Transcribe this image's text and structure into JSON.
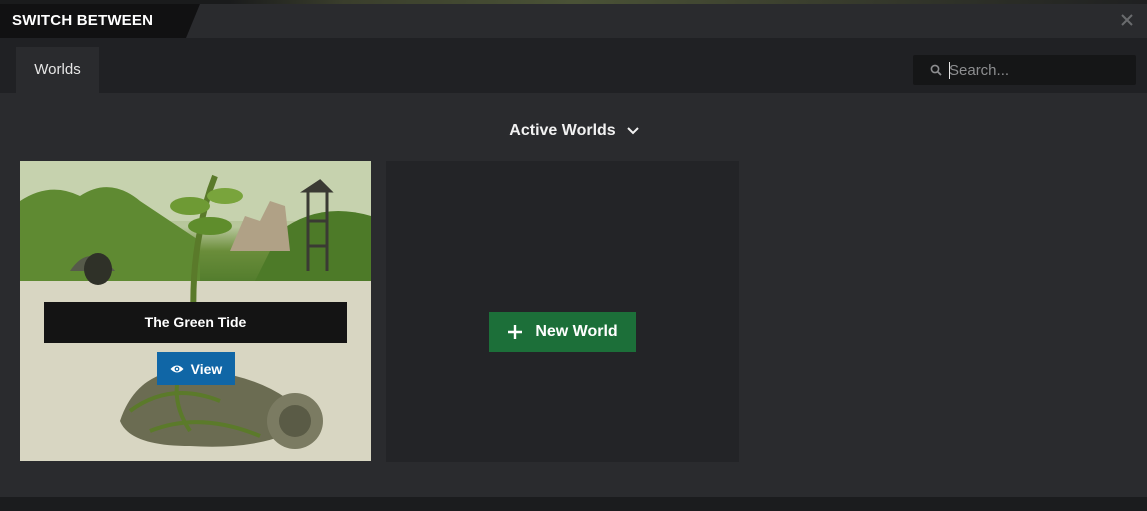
{
  "dialog": {
    "title": "SWITCH BETWEEN",
    "close_icon": "close-icon"
  },
  "tabs": [
    {
      "label": "Worlds",
      "active": true
    }
  ],
  "search": {
    "placeholder": "Search...",
    "value": "",
    "icon": "search-icon"
  },
  "section": {
    "title": "Active Worlds",
    "icon": "chevron-down-icon"
  },
  "worlds": [
    {
      "name": "The Green Tide",
      "view_label": "View",
      "view_icon": "eye-icon"
    }
  ],
  "new_world": {
    "label": "New World",
    "icon": "plus-icon"
  },
  "colors": {
    "view_button": "#1066a6",
    "new_world_button": "#1c6f39",
    "modal_bg": "#2a2b2e"
  }
}
